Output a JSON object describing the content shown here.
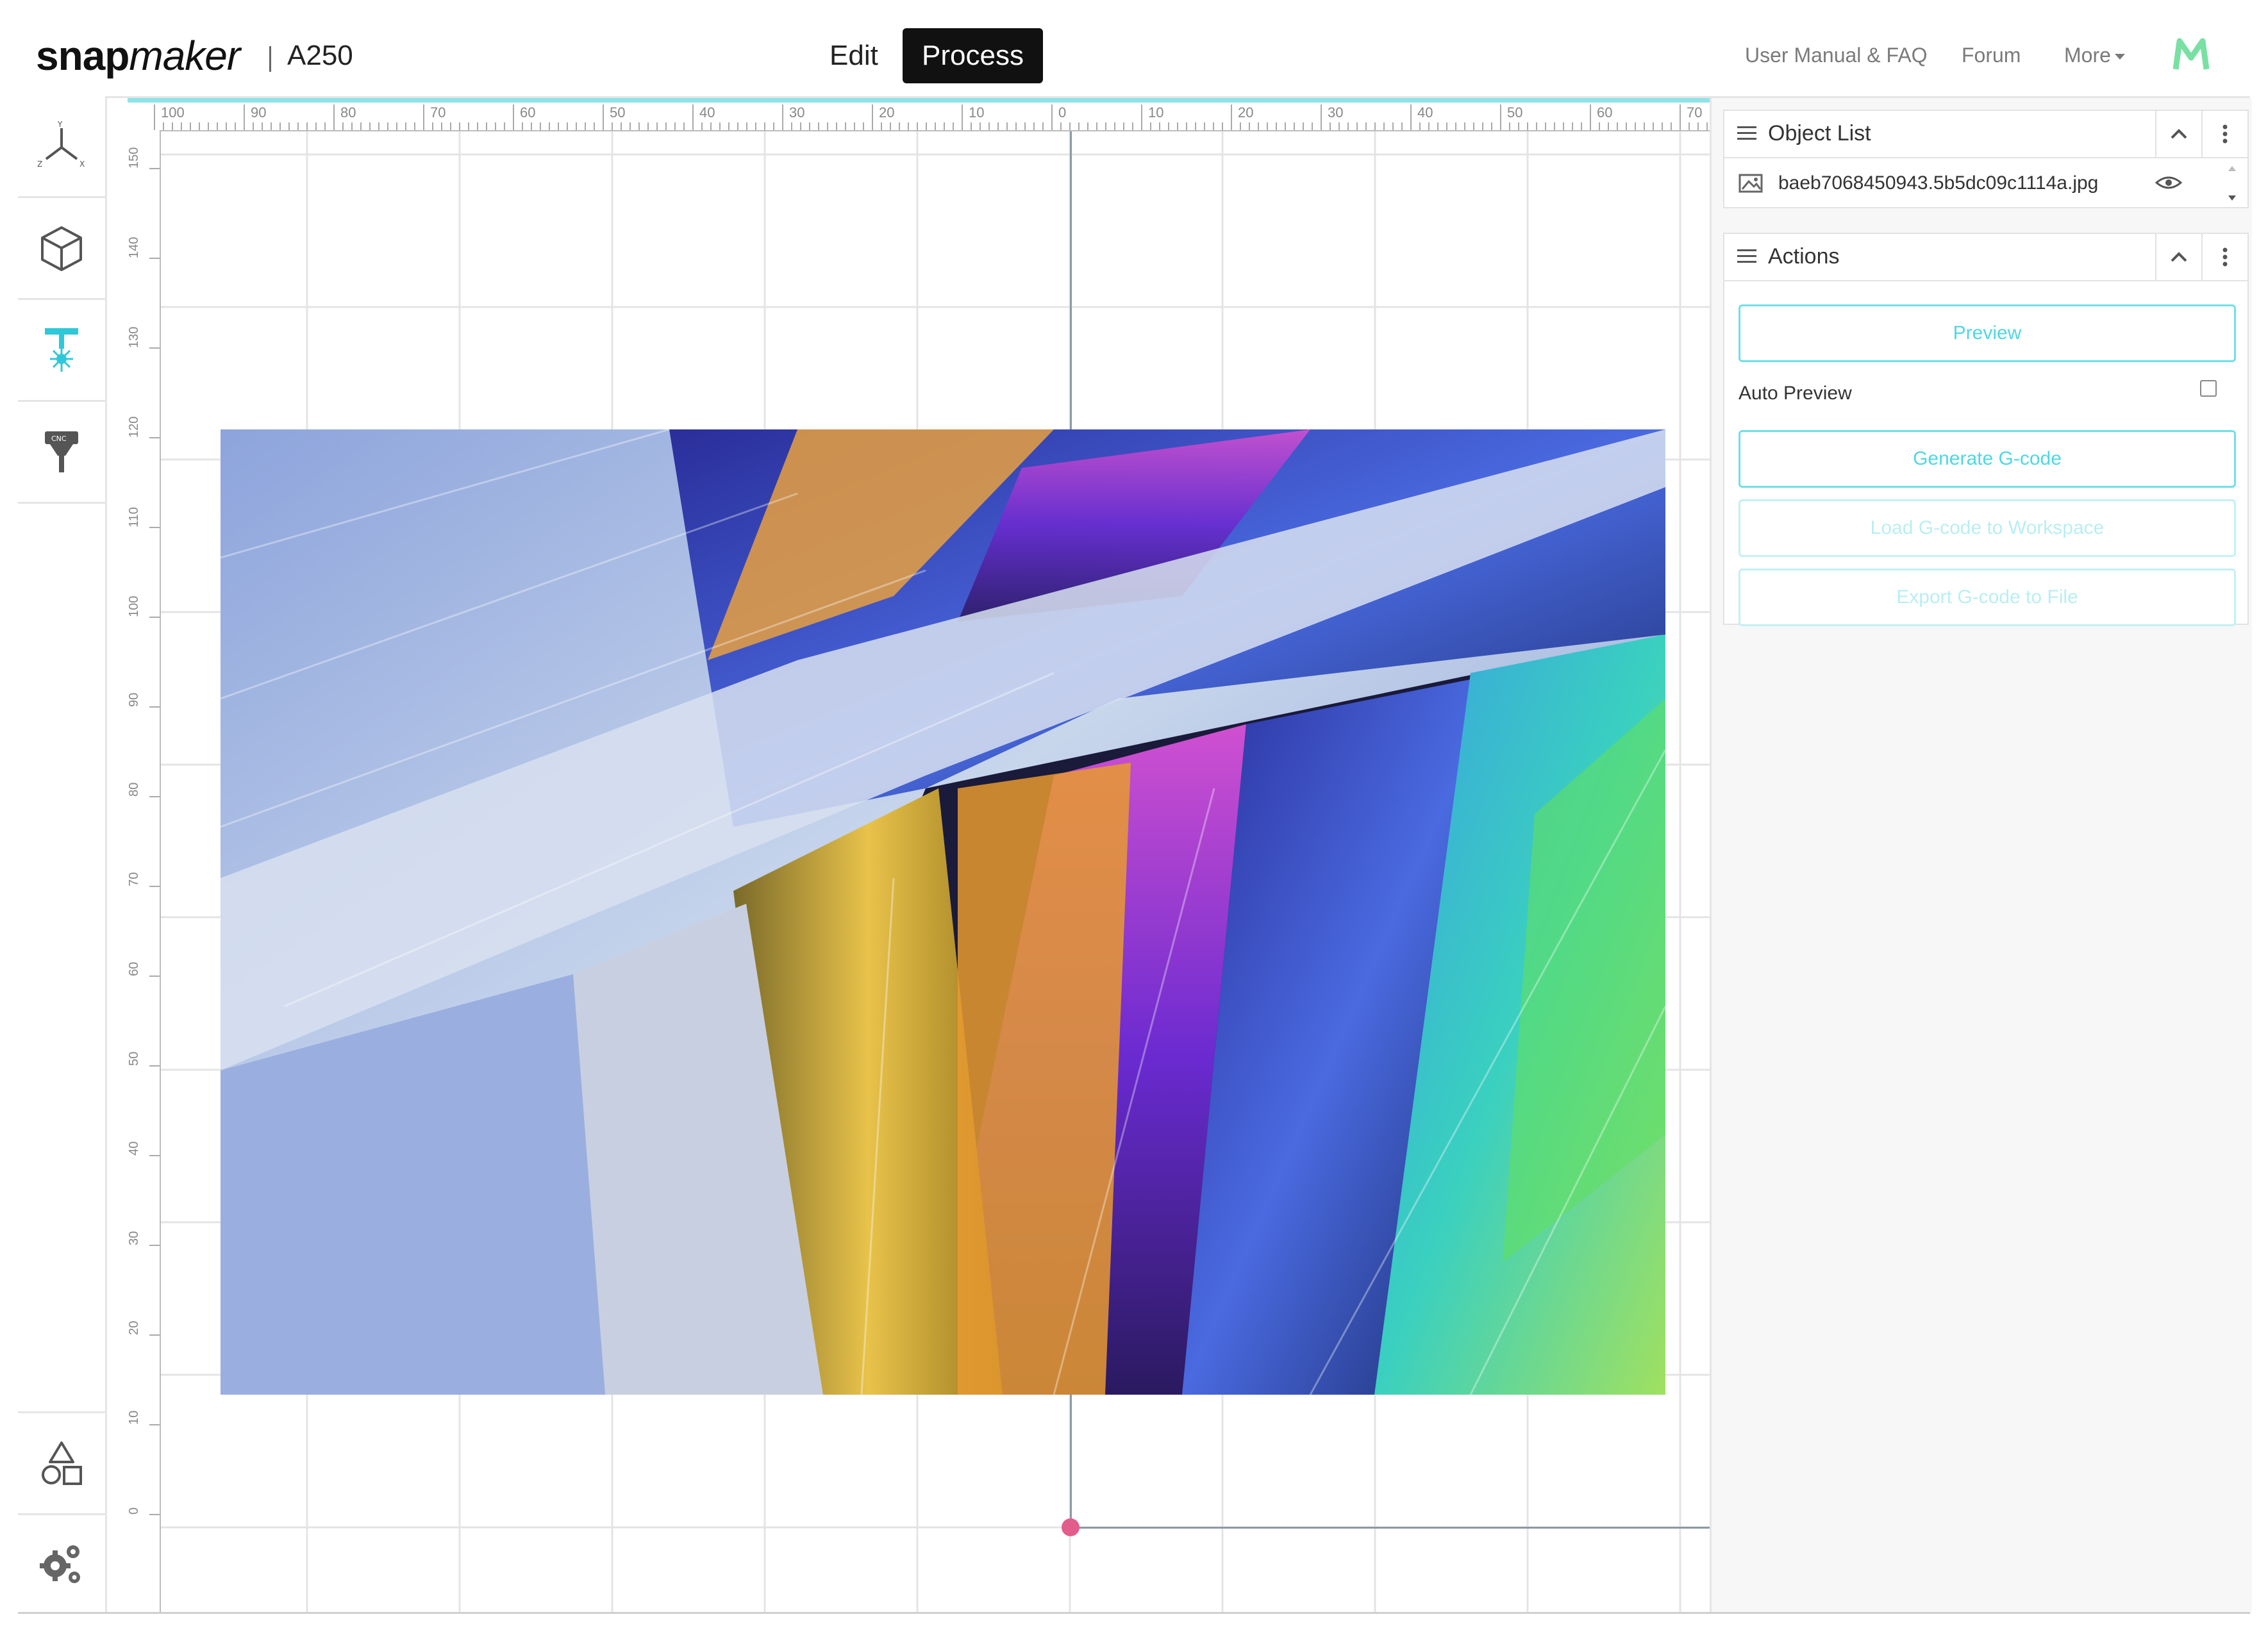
{
  "header": {
    "brand": "snapmaker",
    "brand_bold": "snap",
    "brand_light": "maker",
    "model": "A250",
    "tabs": [
      {
        "label": "Edit",
        "active": false
      },
      {
        "label": "Process",
        "active": true
      }
    ],
    "links": {
      "manual": "User Manual & FAQ",
      "forum": "Forum",
      "more": "More"
    },
    "accent_color": "#4fd7e2"
  },
  "rail": {
    "tools": [
      {
        "name": "axis-icon",
        "active": false
      },
      {
        "name": "3d-print-cube-icon",
        "active": false
      },
      {
        "name": "laser-icon",
        "active": true
      },
      {
        "name": "cnc-icon",
        "active": false
      }
    ],
    "bottom_tools": [
      {
        "name": "shapes-icon"
      },
      {
        "name": "settings-gears-icon"
      }
    ]
  },
  "canvas": {
    "ruler_top_labels": [
      "100",
      "90",
      "80",
      "70",
      "60",
      "50",
      "40",
      "30",
      "20",
      "10",
      "0",
      "10",
      "20",
      "30",
      "40",
      "50",
      "60",
      "70"
    ],
    "ruler_left_labels": [
      "150",
      "140",
      "130",
      "120",
      "110",
      "100",
      "90",
      "80",
      "70",
      "60",
      "50",
      "40",
      "30",
      "20",
      "10",
      "0"
    ],
    "image_description_icon": "crystal-photo"
  },
  "object_list": {
    "title": "Object List",
    "items": [
      {
        "name": "baeb7068450943.5b5dc09c1114a.jpg",
        "visible": true
      }
    ]
  },
  "actions": {
    "title": "Actions",
    "preview": "Preview",
    "auto_preview_label": "Auto Preview",
    "auto_preview_checked": false,
    "generate": "Generate G-code",
    "load": "Load G-code to Workspace",
    "export": "Export G-code to File"
  }
}
